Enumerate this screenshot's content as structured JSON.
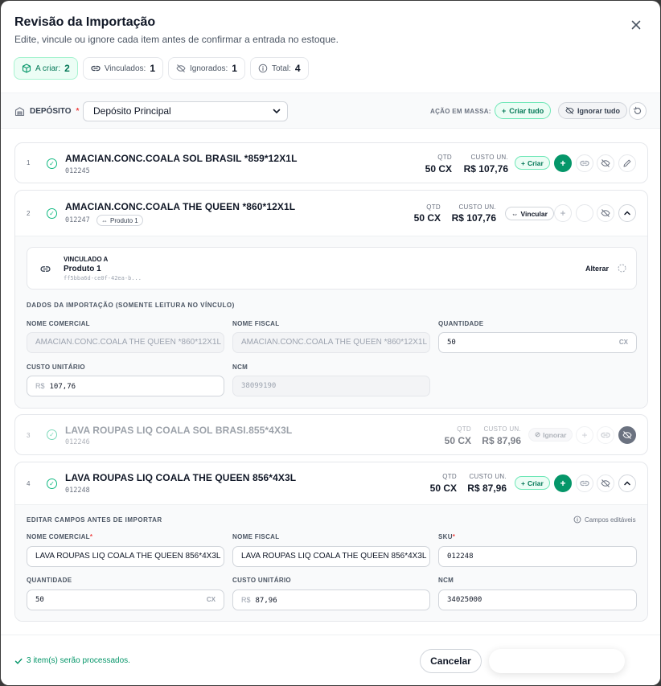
{
  "header": {
    "title": "Revisão da Importação",
    "subtitle": "Edite, vincule ou ignore cada item antes de confirmar a entrada no estoque.",
    "close_icon": "close-icon"
  },
  "summary": [
    {
      "label": "A criar:",
      "count": "2",
      "icon": "package-icon"
    },
    {
      "label": "Vinculados:",
      "count": "1",
      "icon": "link-icon"
    },
    {
      "label": "Ignorados:",
      "count": "1",
      "icon": "eye-off-icon"
    },
    {
      "label": "Total:",
      "count": "4",
      "icon": "info-icon"
    }
  ],
  "deposit": {
    "label": "DEPÓSITO",
    "required": "*",
    "selected": "Depósito Principal",
    "mass_label": "AÇÃO EM MASSA:",
    "create_all": "Criar tudo",
    "ignore_all": "Ignorar tudo"
  },
  "stat_labels": {
    "qty": "QTD",
    "cost": "CUSTO UN."
  },
  "items": [
    {
      "num": "1",
      "name": "AMACIAN.CONC.COALA SOL BRASIL *859*12X1L",
      "code": "012245",
      "qty": "50 CX",
      "cost": "R$ 107,76",
      "mode": "Criar"
    },
    {
      "num": "2",
      "name": "AMACIAN.CONC.COALA THE QUEEN *860*12X1L",
      "code": "012247",
      "tag": "Produto 1",
      "qty": "50 CX",
      "cost": "R$ 107,76",
      "mode": "Vincular"
    },
    {
      "num": "3",
      "name": "LAVA ROUPAS LIQ COALA SOL BRASI.855*4X3L",
      "code": "012246",
      "qty": "50 CX",
      "cost": "R$ 87,96",
      "mode": "Ignorar"
    },
    {
      "num": "4",
      "name": "LAVA ROUPAS LIQ COALA THE QUEEN 856*4X3L",
      "code": "012248",
      "qty": "50 CX",
      "cost": "R$ 87,96",
      "mode": "Criar"
    }
  ],
  "linked": {
    "kicker": "VINCULADO A",
    "name": "Produto 1",
    "id": "ff5bba6d-ce0f-42ea-b...",
    "alter": "Alterar",
    "section": "DADOS DA IMPORTAÇÃO (SOMENTE LEITURA NO VÍNCULO)",
    "labels": {
      "nome_comercial": "NOME COMERCIAL",
      "nome_fiscal": "NOME FISCAL",
      "quantidade": "QUANTIDADE",
      "custo": "CUSTO UNITÁRIO",
      "ncm": "NCM"
    },
    "values": {
      "nome_comercial": "AMACIAN.CONC.COALA THE QUEEN *860*12X1L",
      "nome_fiscal": "AMACIAN.CONC.COALA THE QUEEN *860*12X1L",
      "quantidade": "50",
      "qty_unit": "CX",
      "currency": "R$",
      "custo": "107,76",
      "ncm": "38099190"
    }
  },
  "edit": {
    "section": "EDITAR CAMPOS ANTES DE IMPORTAR",
    "editable": "Campos editáveis",
    "required": "*",
    "labels": {
      "nome_comercial": "NOME COMERCIAL",
      "nome_fiscal": "NOME FISCAL",
      "sku": "SKU",
      "quantidade": "QUANTIDADE",
      "custo": "CUSTO UNITÁRIO",
      "ncm": "NCM"
    },
    "values": {
      "nome_comercial": "LAVA ROUPAS LIQ COALA THE QUEEN 856*4X3L",
      "nome_fiscal": "LAVA ROUPAS LIQ COALA THE QUEEN 856*4X3L",
      "sku": "012248",
      "quantidade": "50",
      "qty_unit": "CX",
      "currency": "R$",
      "custo": "87,96",
      "ncm": "34025000"
    }
  },
  "footer": {
    "message": "3 item(s) serão processados.",
    "cancel": "Cancelar"
  }
}
